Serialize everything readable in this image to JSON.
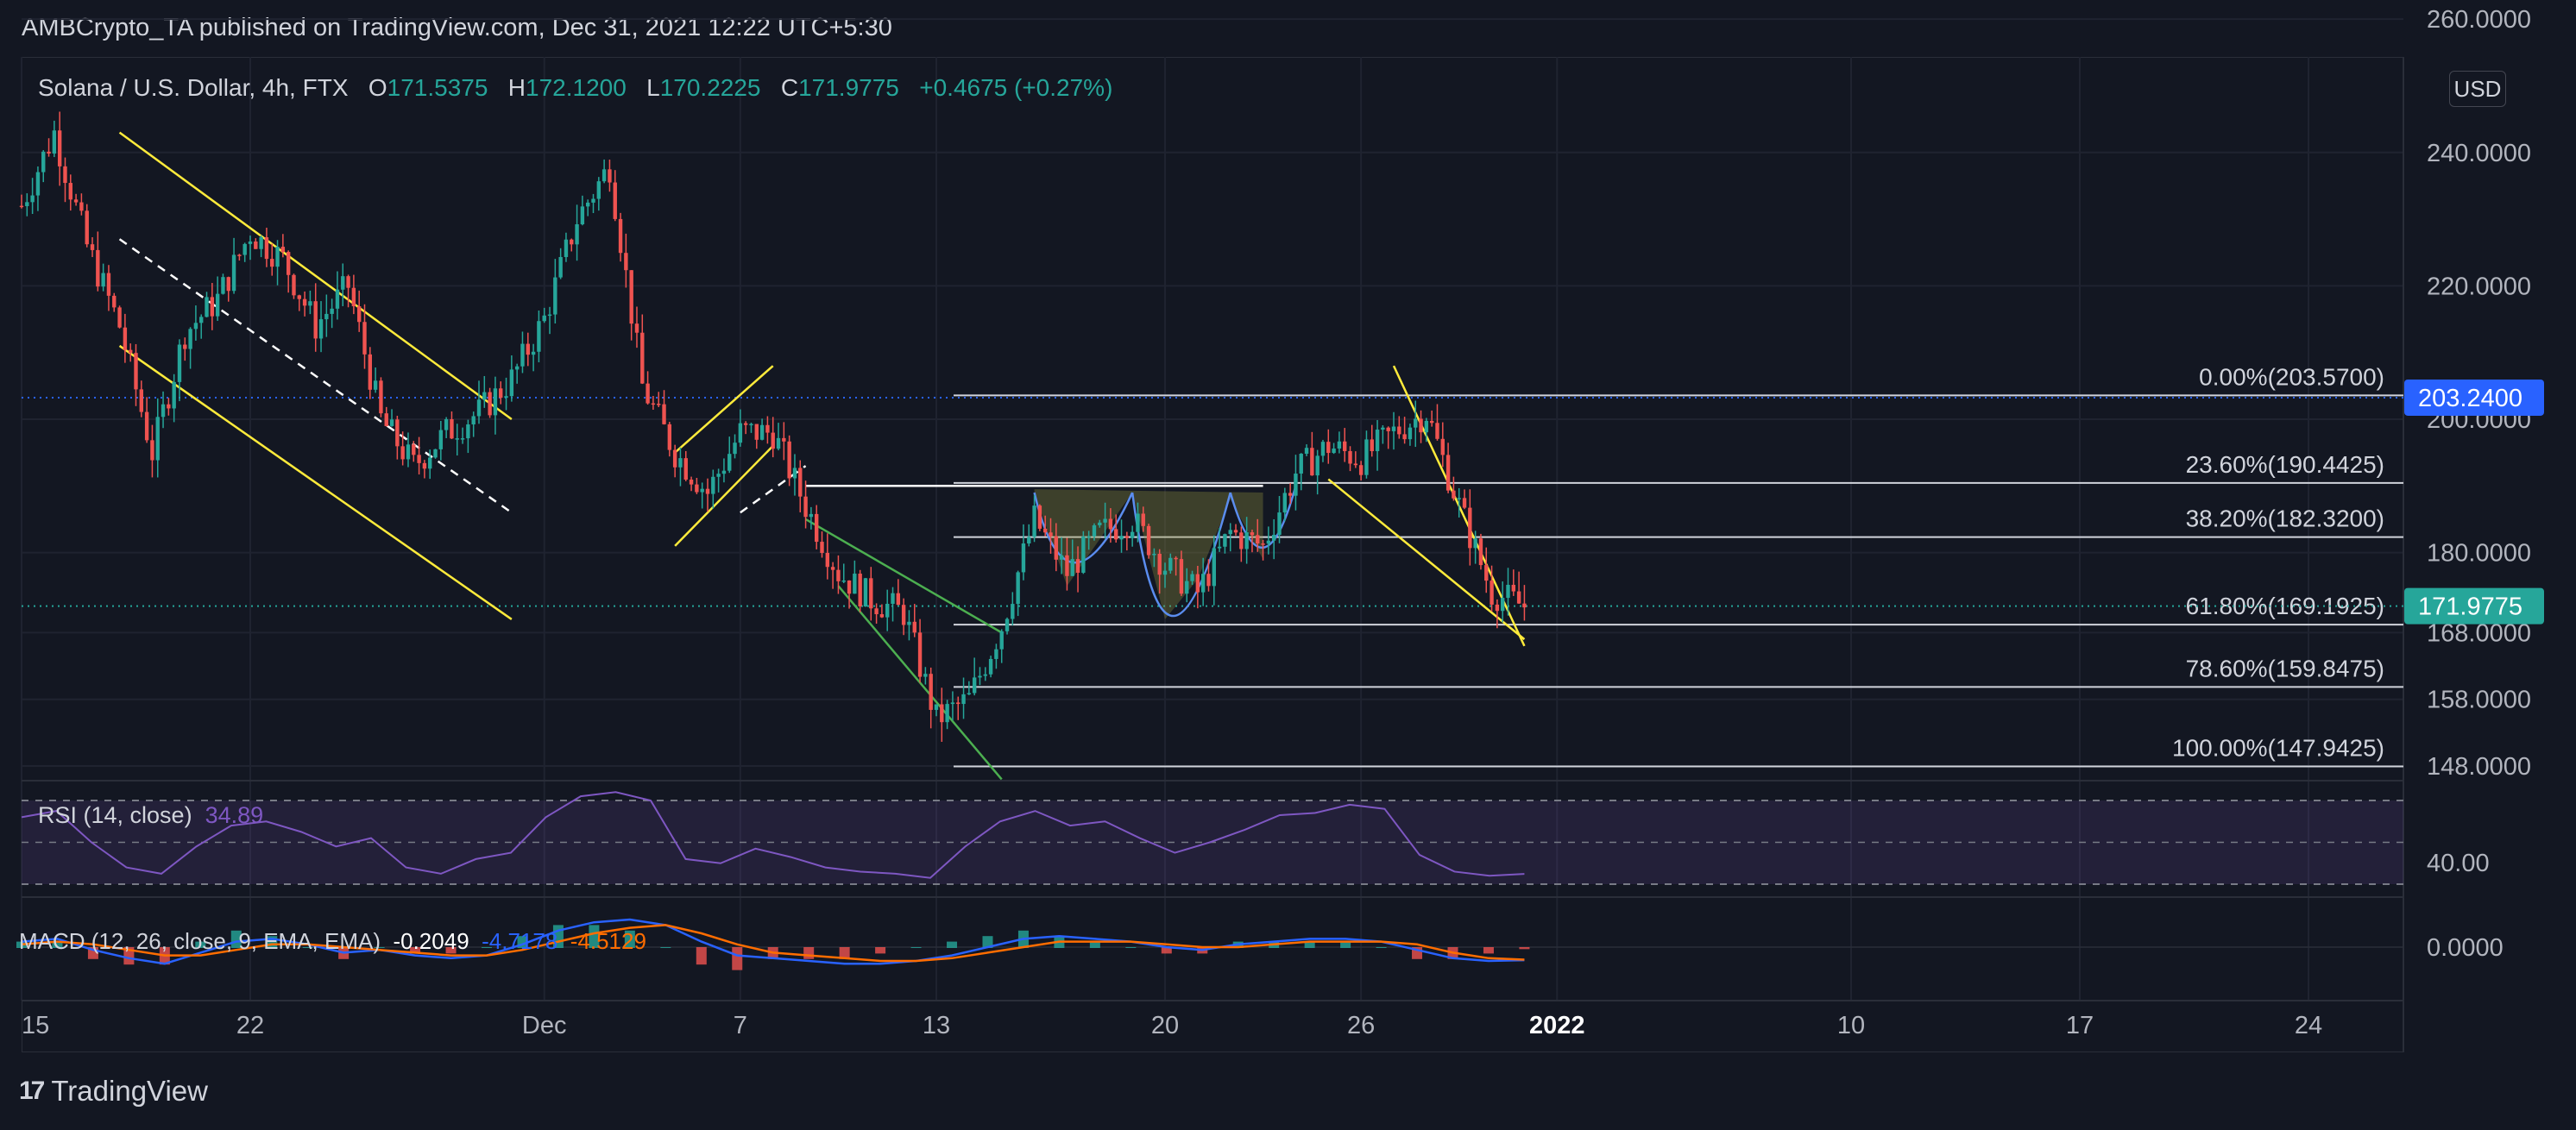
{
  "header": {
    "publisher": "AMBCrypto_TA published on TradingView.com, Dec 31, 2021 12:22 UTC+5:30"
  },
  "legend": {
    "symbol": "Solana / U.S. Dollar, 4h, FTX",
    "o_label": "O",
    "o": "171.5375",
    "h_label": "H",
    "h": "172.1200",
    "l_label": "L",
    "l": "170.2225",
    "c_label": "C",
    "c": "171.9775",
    "change": "+0.4675 (+0.27%)"
  },
  "currency": "USD",
  "colors": {
    "background": "#131722",
    "up": "#26a69a",
    "down": "#ef5350",
    "yellow": "#ffeb3b",
    "rsi": "#7e57c2",
    "macd": "#2962ff",
    "signal": "#ff6d00",
    "tag_blue": "#2962ff",
    "tag_green": "#26a69a"
  },
  "chart_data": {
    "type": "candlestick",
    "price_axis": {
      "ticks": [
        "260.0000",
        "240.0000",
        "220.0000",
        "200.0000",
        "180.0000",
        "168.0000",
        "158.0000",
        "148.0000"
      ],
      "tick_values": [
        260,
        240,
        220,
        200,
        180,
        168,
        158,
        148
      ]
    },
    "price_tags": [
      {
        "label": "203.2400",
        "value": 203.24,
        "kind": "blue"
      },
      {
        "label": "171.9775",
        "value": 171.9775,
        "kind": "green"
      }
    ],
    "time_axis": {
      "labels": [
        "15",
        "22",
        "Dec",
        "7",
        "13",
        "20",
        "26",
        "2022",
        "10",
        "17",
        "24"
      ],
      "dates": [
        "2021-11-15",
        "2021-11-22",
        "2021-12-01",
        "2021-12-07",
        "2021-12-13",
        "2021-12-20",
        "2021-12-26",
        "2022-01-01",
        "2022-01-10",
        "2022-01-17",
        "2022-01-24"
      ],
      "bold": [
        false,
        false,
        false,
        false,
        false,
        false,
        false,
        true,
        false,
        false,
        false
      ]
    },
    "close_path": [
      [
        "2021-11-15",
        232
      ],
      [
        "2021-11-16",
        243
      ],
      [
        "2021-11-17",
        226
      ],
      [
        "2021-11-18",
        214
      ],
      [
        "2021-11-19",
        195
      ],
      [
        "2021-11-20",
        213
      ],
      [
        "2021-11-21",
        218
      ],
      [
        "2021-11-22",
        228
      ],
      [
        "2021-11-23",
        224
      ],
      [
        "2021-11-24",
        214
      ],
      [
        "2021-11-25",
        220
      ],
      [
        "2021-11-26",
        200
      ],
      [
        "2021-11-27",
        193
      ],
      [
        "2021-11-28",
        198
      ],
      [
        "2021-11-29",
        201
      ],
      [
        "2021-11-30",
        206
      ],
      [
        "2021-12-01",
        215
      ],
      [
        "2021-12-02",
        230
      ],
      [
        "2021-12-03",
        238
      ],
      [
        "2021-12-04",
        205
      ],
      [
        "2021-12-05",
        195
      ],
      [
        "2021-12-06",
        189
      ],
      [
        "2021-12-07",
        198
      ],
      [
        "2021-12-08",
        198
      ],
      [
        "2021-12-09",
        187
      ],
      [
        "2021-12-10",
        177
      ],
      [
        "2021-12-11",
        173
      ],
      [
        "2021-12-12",
        171
      ],
      [
        "2021-12-13",
        155
      ],
      [
        "2021-12-14",
        158
      ],
      [
        "2021-12-15",
        169
      ],
      [
        "2021-12-16",
        185
      ],
      [
        "2021-12-17",
        177
      ],
      [
        "2021-12-18",
        183
      ],
      [
        "2021-12-19",
        185
      ],
      [
        "2021-12-20",
        178
      ],
      [
        "2021-12-21",
        174
      ],
      [
        "2021-12-22",
        183
      ],
      [
        "2021-12-23",
        181
      ],
      [
        "2021-12-24",
        192
      ],
      [
        "2021-12-25",
        196
      ],
      [
        "2021-12-26",
        194
      ],
      [
        "2021-12-27",
        198
      ],
      [
        "2021-12-28",
        201
      ],
      [
        "2021-12-29",
        187
      ],
      [
        "2021-12-30",
        174
      ],
      [
        "2021-12-31",
        171.98
      ]
    ],
    "fib_levels": [
      {
        "label": "0.00%(203.5700)",
        "value": 203.57
      },
      {
        "label": "23.60%(190.4425)",
        "value": 190.4425
      },
      {
        "label": "38.20%(182.3200)",
        "value": 182.32
      },
      {
        "label": "61.80%(169.1925)",
        "value": 169.1925
      },
      {
        "label": "78.60%(159.8475)",
        "value": 159.8475
      },
      {
        "label": "100.00%(147.9425)",
        "value": 147.9425
      }
    ],
    "rsi": {
      "title": "RSI (14, close)",
      "value": "34.89",
      "ticks": [
        "40.00"
      ],
      "values": [
        62,
        65,
        50,
        38,
        35,
        48,
        58,
        60,
        55,
        48,
        52,
        38,
        35,
        42,
        45,
        62,
        72,
        74,
        70,
        42,
        40,
        47,
        43,
        38,
        36,
        35,
        33,
        48,
        60,
        65,
        58,
        60,
        52,
        45,
        50,
        56,
        63,
        64,
        68,
        66,
        44,
        36,
        34,
        34.89
      ]
    },
    "macd": {
      "title": "MACD (12, 26, close, 9, EMA, EMA)",
      "histogram": "-0.2049",
      "macd": "-4.7178",
      "signal": "-4.5129",
      "ticks": [
        "0.0000"
      ],
      "macd_values": [
        2,
        3,
        -1,
        -4,
        -6,
        -2,
        2,
        3,
        1,
        -2,
        -1,
        -3,
        -4,
        -3,
        1,
        6,
        9,
        10,
        8,
        2,
        -3,
        -4,
        -5,
        -6,
        -6,
        -5,
        -3,
        0,
        3,
        4,
        3,
        2,
        0,
        -1,
        1,
        2,
        3,
        3,
        2,
        -1,
        -4,
        -5,
        -4.7178
      ],
      "signal_values": [
        1,
        2,
        1,
        -1,
        -3,
        -3,
        -1,
        1,
        1,
        0,
        -1,
        -2,
        -3,
        -3,
        -1,
        2,
        5,
        7,
        8,
        5,
        1,
        -2,
        -3,
        -4,
        -5,
        -5,
        -4,
        -2,
        0,
        2,
        2,
        2,
        1,
        0,
        0,
        1,
        2,
        2,
        2,
        1,
        -2,
        -4,
        -4.5129
      ]
    },
    "legend_placement": "top-left",
    "grid": true
  },
  "branding": {
    "name": "TradingView",
    "mark": "17"
  }
}
